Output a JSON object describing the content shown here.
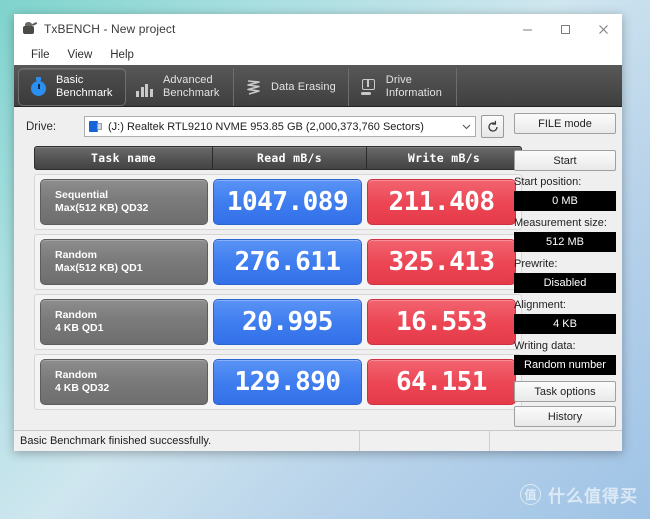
{
  "window": {
    "title": "TxBENCH - New project",
    "app_icon": "txbench-icon",
    "controls": {
      "minimize": "minimize-icon",
      "maximize": "maximize-icon",
      "close": "close-icon"
    }
  },
  "menubar": {
    "items": [
      "File",
      "View",
      "Help"
    ]
  },
  "tabs": [
    {
      "label": "Basic\nBenchmark",
      "icon": "stopwatch-icon",
      "active": true
    },
    {
      "label": "Advanced\nBenchmark",
      "icon": "bar-chart-icon",
      "active": false
    },
    {
      "label": "Data Erasing",
      "icon": "shred-icon",
      "active": false
    },
    {
      "label": "Drive\nInformation",
      "icon": "drive-info-icon",
      "active": false
    }
  ],
  "drive": {
    "label": "Drive:",
    "value": "(J:) Realtek RTL9210 NVME  953.85 GB (2,000,373,760 Sectors)",
    "dropdown_icon": "chevron-down-icon",
    "refresh_icon": "refresh-icon"
  },
  "results": {
    "headers": [
      "Task name",
      "Read mB/s",
      "Write mB/s"
    ],
    "rows": [
      {
        "task_line1": "Sequential",
        "task_line2": "Max(512 KB) QD32",
        "read": "1047.089",
        "write": "211.408"
      },
      {
        "task_line1": "Random",
        "task_line2": "Max(512 KB) QD1",
        "read": "276.611",
        "write": "325.413"
      },
      {
        "task_line1": "Random",
        "task_line2": "4 KB QD1",
        "read": "20.995",
        "write": "16.553"
      },
      {
        "task_line1": "Random",
        "task_line2": "4 KB QD32",
        "read": "129.890",
        "write": "64.151"
      }
    ]
  },
  "sidebar": {
    "mode_button": "FILE mode",
    "start_button": "Start",
    "fields": [
      {
        "caption": "Start position:",
        "value": "0 MB"
      },
      {
        "caption": "Measurement size:",
        "value": "512 MB"
      },
      {
        "caption": "Prewrite:",
        "value": "Disabled"
      },
      {
        "caption": "Alignment:",
        "value": "4 KB"
      },
      {
        "caption": "Writing data:",
        "value": "Random number"
      }
    ],
    "task_options_button": "Task options",
    "history_button": "History"
  },
  "statusbar": {
    "message": "Basic Benchmark finished successfully."
  },
  "watermark": {
    "logo": "值",
    "text": "什么值得买"
  },
  "colors": {
    "read_accent": "#3d7cef",
    "write_accent": "#ec4553",
    "tab_active_icon": "#2a8ff0",
    "lcd_bg": "#000000",
    "desktop_gradient_start": "#7fd4cd",
    "desktop_gradient_end": "#9fc3e6"
  }
}
